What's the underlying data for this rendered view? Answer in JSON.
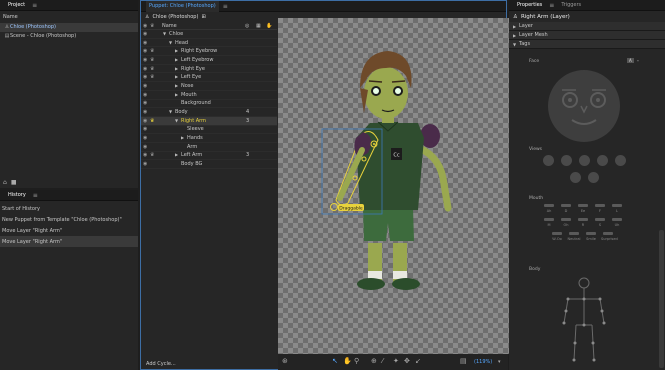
{
  "project": {
    "tab": "Project",
    "column": "Name",
    "items": [
      "Chloe (Photoshop)",
      "Scene - Chloe (Photoshop)"
    ]
  },
  "history": {
    "tab": "History",
    "items": [
      "Start of History",
      "New Puppet from Template \"Chloe (Photoshop)\"",
      "Move Layer \"Right Arm\"",
      "Move Layer \"Right Arm\""
    ]
  },
  "puppet": {
    "tab": "Puppet: Chloe (Photoshop)",
    "title": "Chloe (Photoshop)",
    "column": "Name",
    "layers": [
      {
        "label": "Chloe",
        "indent": 0,
        "tri": "down",
        "count": ""
      },
      {
        "label": "Head",
        "indent": 1,
        "tri": "down",
        "count": ""
      },
      {
        "label": "Right Eyebrow",
        "indent": 2,
        "tri": "right",
        "count": ""
      },
      {
        "label": "Left Eyebrow",
        "indent": 2,
        "tri": "right",
        "count": ""
      },
      {
        "label": "Right Eye",
        "indent": 2,
        "tri": "right",
        "count": ""
      },
      {
        "label": "Left Eye",
        "indent": 2,
        "tri": "right",
        "count": ""
      },
      {
        "label": "Nose",
        "indent": 2,
        "tri": "right",
        "count": ""
      },
      {
        "label": "Mouth",
        "indent": 2,
        "tri": "right",
        "count": ""
      },
      {
        "label": "Background",
        "indent": 2,
        "tri": "",
        "count": ""
      },
      {
        "label": "Body",
        "indent": 1,
        "tri": "down",
        "count": "4"
      },
      {
        "label": "Right Arm",
        "indent": 2,
        "tri": "down",
        "count": "3",
        "selected": true
      },
      {
        "label": "Sleeve",
        "indent": 3,
        "tri": "",
        "count": ""
      },
      {
        "label": "Hands",
        "indent": 3,
        "tri": "right",
        "count": ""
      },
      {
        "label": "Arm",
        "indent": 3,
        "tri": "",
        "count": ""
      },
      {
        "label": "Left Arm",
        "indent": 2,
        "tri": "right",
        "count": "3"
      },
      {
        "label": "Body BG",
        "indent": 2,
        "tri": "",
        "count": ""
      }
    ],
    "add_cycle": "Add Cycle...",
    "zoom": "(119%)",
    "handle_label": "Draggable",
    "shirt_logo": "Cc"
  },
  "properties": {
    "tabs": [
      "Properties",
      "Triggers"
    ],
    "layer_name": "Right Arm (Layer)",
    "sections": [
      "Layer",
      "Layer Mesh",
      "Tags"
    ],
    "face_label": "Face",
    "views_label": "Views",
    "mouth_label": "Mouth",
    "body_label": "Body",
    "mouth_shapes": [
      "Ah",
      "D",
      "Ee",
      "F",
      "L",
      "M",
      "Oh",
      "R",
      "S",
      "Uh",
      "W-Oo",
      "Neutral",
      "Smile",
      "Surprised"
    ]
  }
}
